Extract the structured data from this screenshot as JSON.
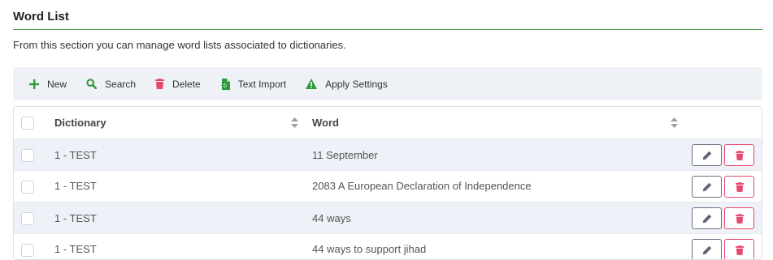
{
  "section": {
    "title": "Word List",
    "description": "From this section you can manage word lists associated to dictionaries."
  },
  "toolbar": {
    "buttons": [
      {
        "label": "New",
        "icon": "plus-icon",
        "color": "#2e9a3a"
      },
      {
        "label": "Search",
        "icon": "search-icon",
        "color": "#2e9a3a"
      },
      {
        "label": "Delete",
        "icon": "trash-icon",
        "color": "#e8476b"
      },
      {
        "label": "Text Import",
        "icon": "file-import-icon",
        "color": "#2e9a3a"
      },
      {
        "label": "Apply Settings",
        "icon": "warning-icon",
        "color": "#2e9a3a"
      }
    ]
  },
  "table": {
    "columns": [
      "Dictionary",
      "Word"
    ],
    "rows": [
      {
        "dictionary": "1 - TEST",
        "word": "11 September"
      },
      {
        "dictionary": "1 - TEST",
        "word": "2083 A European Declaration of Independence"
      },
      {
        "dictionary": "1 - TEST",
        "word": "44 ways"
      },
      {
        "dictionary": "1 - TEST",
        "word": "44 ways to support jihad"
      }
    ]
  },
  "colors": {
    "accent_green": "#3d9a3d",
    "danger": "#e8476b",
    "toolbar_bg": "#eef1f5",
    "row_alt_bg": "#eef1f7"
  }
}
